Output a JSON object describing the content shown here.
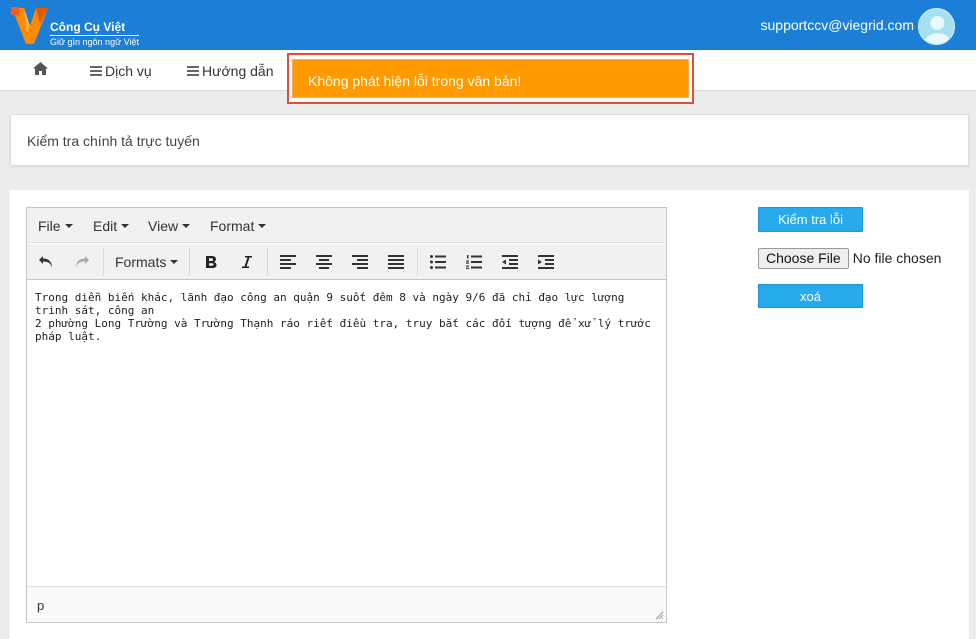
{
  "header": {
    "logo_title": "Công Cụ Việt",
    "logo_subtitle": "Giữ gìn ngôn ngữ Việt",
    "user_email": "supportccv@viegrid.com",
    "brand_color": "#1b7fd8"
  },
  "nav": {
    "home_icon": "home-icon",
    "items": [
      {
        "label": "Dịch vụ",
        "icon": "menu-lines-icon"
      },
      {
        "label": "Hướng dẫn",
        "icon": "menu-lines-icon"
      }
    ]
  },
  "toast": {
    "message": "Không phát hiện lỗi trong văn bản!",
    "color": "#ff9b00",
    "highlight_border": "#e04b42"
  },
  "page": {
    "title": "Kiểm tra chính tả trực tuyến"
  },
  "editor": {
    "menus": [
      "File",
      "Edit",
      "View",
      "Format"
    ],
    "formats_label": "Formats",
    "toolbar_icons": [
      "undo-icon",
      "redo-icon",
      "bold-icon",
      "italic-icon",
      "align-left-icon",
      "align-center-icon",
      "align-right-icon",
      "align-justify-icon",
      "bullet-list-icon",
      "numbered-list-icon",
      "outdent-icon",
      "indent-icon"
    ],
    "content_line1": "Trong diễn biến khác, lãnh đạo công an quận 9 suốt đêm 8 và ngày 9/6 đã chỉ đạo lực lượng trinh sát, công an",
    "content_line2": "2 phường Long Trường và Trường Thạnh ráo riết điều tra, truy bắt các đối tượng để xử lý trước pháp luật.",
    "status_path": "p"
  },
  "actions": {
    "check_label": "Kiểm tra lỗi",
    "choose_file_label": "Choose File",
    "file_status": "No file chosen",
    "clear_label": "xoá",
    "button_color": "#27aaeb"
  }
}
